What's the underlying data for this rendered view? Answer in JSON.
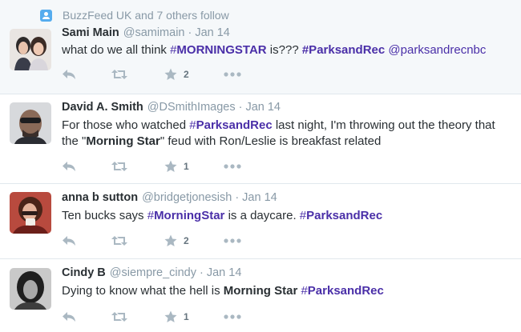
{
  "tweets": [
    {
      "follow_context": "BuzzFeed UK and 7 others follow",
      "fullname": "Sami Main",
      "handle": "@samimain",
      "time": "Jan 14",
      "text_parts": [
        {
          "t": "what do we all think ",
          "k": "plain"
        },
        {
          "t": "#",
          "k": "hash"
        },
        {
          "t": "MORNINGSTAR",
          "k": "hashbold"
        },
        {
          "t": " is??? ",
          "k": "plain"
        },
        {
          "t": "#ParksandRec",
          "k": "hashbold"
        },
        {
          "t": " ",
          "k": "plain"
        },
        {
          "t": "@parksandrecnbc",
          "k": "mention"
        }
      ],
      "favorites": "2"
    },
    {
      "fullname": "David A. Smith",
      "handle": "@DSmithImages",
      "time": "Jan 14",
      "text_parts": [
        {
          "t": "For those who watched ",
          "k": "plain"
        },
        {
          "t": "#",
          "k": "hash"
        },
        {
          "t": "ParksandRec",
          "k": "hashbold"
        },
        {
          "t": " last night, I'm throwing out the theory that the \"",
          "k": "plain"
        },
        {
          "t": "Morning Star",
          "k": "strong"
        },
        {
          "t": "\" feud with Ron/Leslie is breakfast related",
          "k": "plain"
        }
      ],
      "favorites": "1"
    },
    {
      "fullname": "anna b sutton",
      "handle": "@bridgetjonesish",
      "time": "Jan 14",
      "text_parts": [
        {
          "t": "Ten bucks says ",
          "k": "plain"
        },
        {
          "t": "#",
          "k": "hash"
        },
        {
          "t": "MorningStar",
          "k": "hashbold"
        },
        {
          "t": " is a daycare. ",
          "k": "plain"
        },
        {
          "t": "#",
          "k": "hash"
        },
        {
          "t": "ParksandRec",
          "k": "hashbold"
        }
      ],
      "favorites": "2"
    },
    {
      "fullname": "Cindy B",
      "handle": "@siempre_cindy",
      "time": "Jan 14",
      "text_parts": [
        {
          "t": "Dying to know what the hell is ",
          "k": "plain"
        },
        {
          "t": "Morning Star",
          "k": "strong"
        },
        {
          "t": " ",
          "k": "plain"
        },
        {
          "t": "#",
          "k": "hash"
        },
        {
          "t": "ParksandRec",
          "k": "hashbold"
        }
      ],
      "favorites": "1"
    }
  ],
  "colors": {
    "link": "#4a2fa8",
    "muted": "#8899a6",
    "icon": "#aab8c2",
    "text": "#292f33",
    "highlight_bg": "#f5f8fa"
  },
  "icons": [
    "person-follow-icon",
    "reply-icon",
    "retweet-icon",
    "favorite-star-icon",
    "more-dots-icon"
  ]
}
